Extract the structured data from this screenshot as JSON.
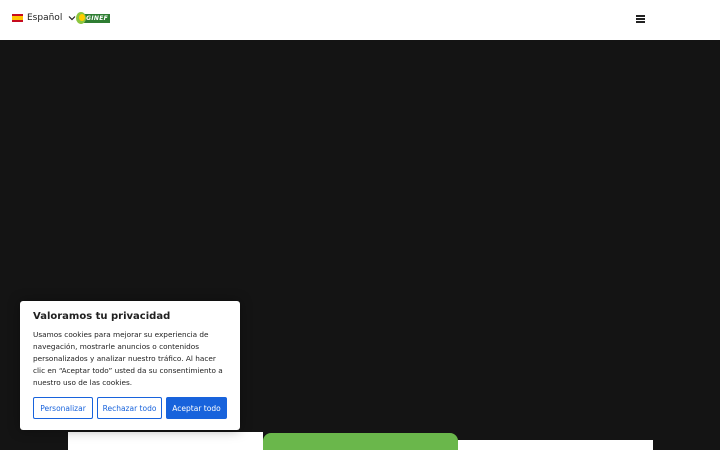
{
  "header": {
    "language": "Español",
    "logo_text": "GINEF"
  },
  "cookie_banner": {
    "title": "Valoramos tu privacidad",
    "body": "Usamos cookies para mejorar su experiencia de navegación, mostrarle anuncios o contenidos personalizados y analizar nuestro tráfico. Al hacer clic en “Aceptar todo” usted da su consentimiento a nuestro uso de las cookies.",
    "buttons": {
      "customize": "Personalizar",
      "reject": "Rechazar todo",
      "accept": "Aceptar todo"
    }
  },
  "colors": {
    "accent": "#1863dc",
    "brand_green": "#6ab74b",
    "hero_bg": "#141414"
  },
  "icons": {
    "language_flag": "spain-flag-icon",
    "language_dropdown": "chevron-down-icon",
    "menu": "hamburger-menu-icon"
  }
}
